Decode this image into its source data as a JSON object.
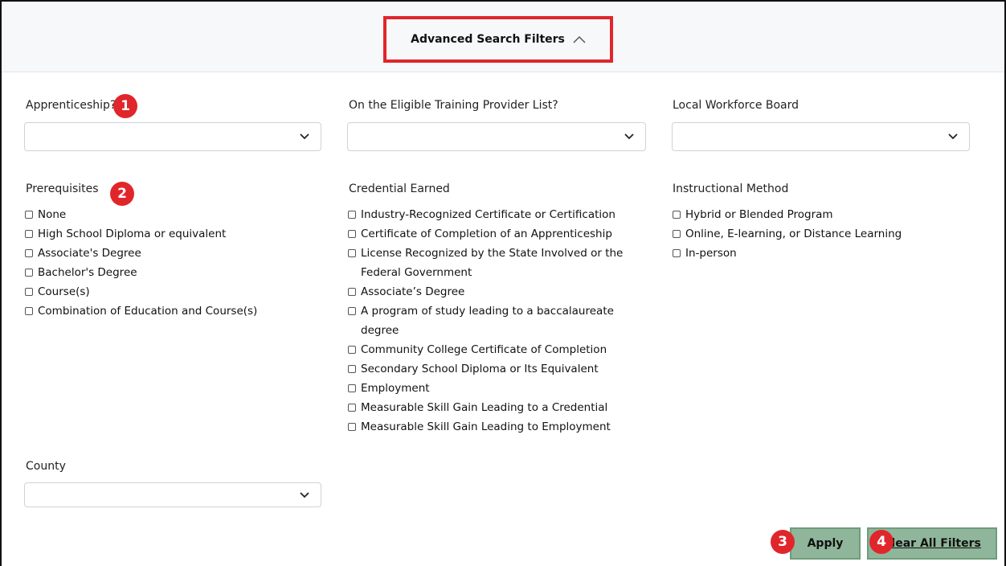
{
  "header": {
    "toggle_label": "Advanced Search Filters"
  },
  "badges": [
    "1",
    "2",
    "3",
    "4"
  ],
  "filters": {
    "apprenticeship": {
      "label": "Apprenticeship?",
      "value": ""
    },
    "etpl": {
      "label": "On the Eligible Training Provider List?",
      "value": ""
    },
    "workforce_board": {
      "label": "Local Workforce Board",
      "value": ""
    },
    "county": {
      "label": "County",
      "value": ""
    }
  },
  "prerequisites": {
    "label": "Prerequisites",
    "options": [
      "None",
      "High School Diploma or equivalent",
      "Associate's Degree",
      "Bachelor's Degree",
      "Course(s)",
      "Combination of Education and Course(s)"
    ]
  },
  "credential": {
    "label": "Credential Earned",
    "options": [
      "Industry-Recognized Certificate or Certification",
      "Certificate of Completion of an Apprenticeship",
      "License Recognized by the State Involved or the Federal Government",
      "Associate’s Degree",
      "A program of study leading to a baccalaureate degree",
      "Community College Certificate of Completion",
      "Secondary School Diploma or Its Equivalent",
      "Employment",
      "Measurable Skill Gain Leading to a Credential",
      "Measurable Skill Gain Leading to Employment"
    ]
  },
  "instructional": {
    "label": "Instructional Method",
    "options": [
      "Hybrid or Blended Program",
      "Online, E-learning, or Distance Learning",
      "In-person"
    ]
  },
  "actions": {
    "apply": "Apply",
    "clear": "Clear All Filters"
  },
  "colors": {
    "accent_red": "#e0262b",
    "button_green": "#8fb69a",
    "border": "#cdd3d8"
  }
}
